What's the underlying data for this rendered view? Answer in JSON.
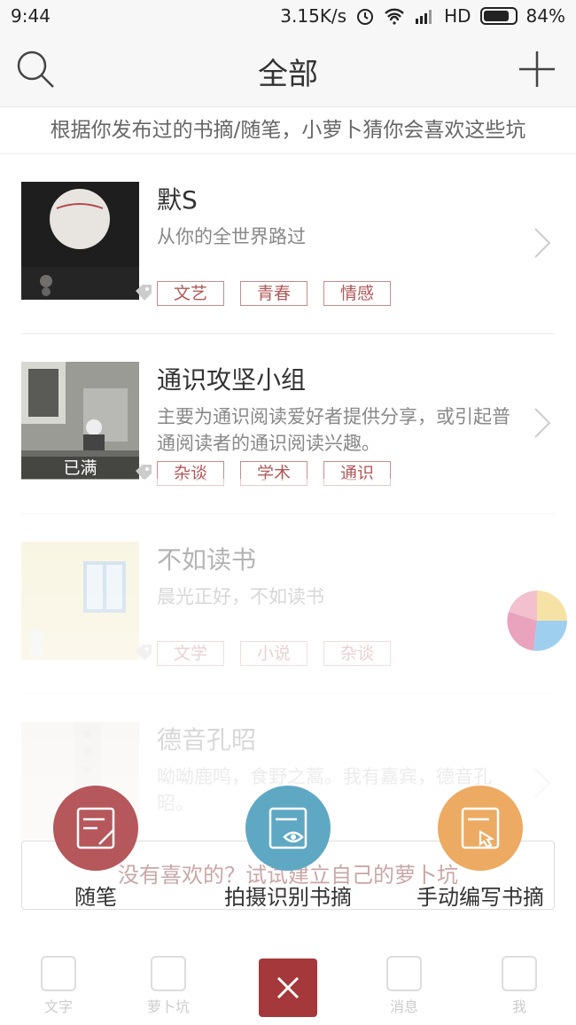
{
  "status": {
    "time": "9:44",
    "speed": "3.15K/s",
    "network": "HD",
    "battery": "84%"
  },
  "header": {
    "title": "全部"
  },
  "hint": "根据你发布过的书摘/随笔，小萝卜猜你会喜欢这些坑",
  "groups": [
    {
      "name": "默S",
      "desc": "从你的全世界路过",
      "tags": [
        "文艺",
        "青春",
        "情感"
      ]
    },
    {
      "name": "通识攻坚小组",
      "desc": "主要为通识阅读爱好者提供分享，或引起普通阅读者的通识阅读兴趣。",
      "full_label": "已满",
      "tags": [
        "杂谈",
        "学术",
        "通识"
      ]
    },
    {
      "name": "不如读书",
      "desc": "晨光正好，不如读书",
      "tags": [
        "文学",
        "小说",
        "杂谈"
      ]
    },
    {
      "name": "德音孔昭",
      "desc": "呦呦鹿鸣，食野之蒿。我有嘉宾，德音孔昭。",
      "tags": []
    }
  ],
  "create_hint": "没有喜欢的？试试建立自己的萝卜坑",
  "tabs": [
    "文字",
    "萝卜坑",
    "消息",
    "我"
  ],
  "actions": [
    {
      "label": "随笔",
      "color": "#b5575b"
    },
    {
      "label": "拍摄识别书摘",
      "color": "#5fa8c3"
    },
    {
      "label": "手动编写书摘",
      "color": "#ecaa62"
    }
  ],
  "close_color": "#a5383a"
}
